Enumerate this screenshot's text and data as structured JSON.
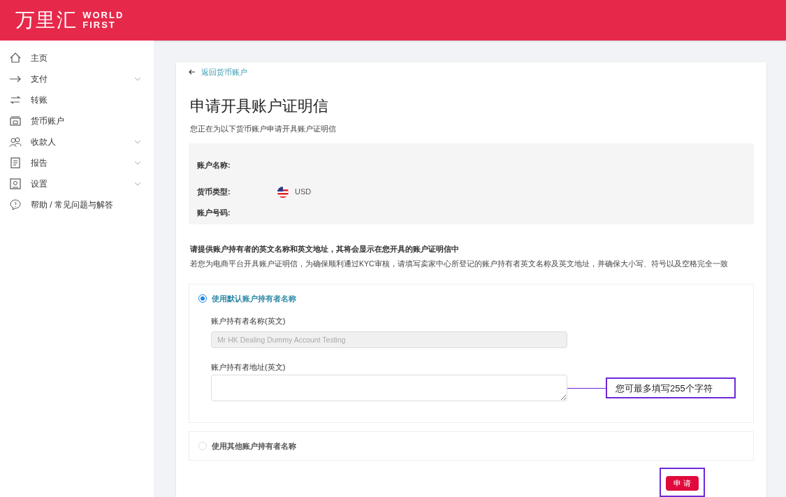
{
  "header": {
    "logo_cn": "万里汇",
    "logo_en_1": "WORLD",
    "logo_en_2": "FIRST"
  },
  "sidebar": {
    "items": [
      {
        "kind": "home",
        "label": "主页",
        "expandable": false
      },
      {
        "kind": "arrow",
        "label": "支付",
        "expandable": true
      },
      {
        "kind": "transfer",
        "label": "转账",
        "expandable": false
      },
      {
        "kind": "wallet",
        "label": "货币账户",
        "expandable": false
      },
      {
        "kind": "people",
        "label": "收款人",
        "expandable": true
      },
      {
        "kind": "report",
        "label": "报告",
        "expandable": true
      },
      {
        "kind": "settings",
        "label": "设置",
        "expandable": true
      },
      {
        "kind": "help",
        "label": "帮助 / 常见问题与解答",
        "expandable": false
      }
    ]
  },
  "back_link": "返回货币账户",
  "title": "申请开具账户证明信",
  "subtitle": "您正在为以下货币账户申请开具账户证明信",
  "account_info": [
    {
      "label": "账户名称:"
    },
    {
      "label": "货币类型:",
      "value": "USD"
    },
    {
      "label": "账户号码:"
    }
  ],
  "instruction_heading": "请提供账户持有者的英文名称和英文地址，其将会显示在您开具的账户证明信中",
  "instruction_note": "若您为电商平台开具账户证明信，为确保顺利通过KYC审核，请填写卖家中心所登记的账户持有者英文名称及英文地址，并确保大小写、符号以及空格完全一致",
  "options": [
    {
      "label": "使用默认账户持有者名称",
      "selected": true,
      "name_label": "账户持有者名称(英文)",
      "name_value": "Mr HK Dealing Dummy Account Testing",
      "address_label": "账户持有者地址(英文)"
    },
    {
      "label": "使用其他账户持有者名称",
      "selected": false
    }
  ],
  "callout": "您可最多填写255个字符",
  "submit_button": "申 请"
}
